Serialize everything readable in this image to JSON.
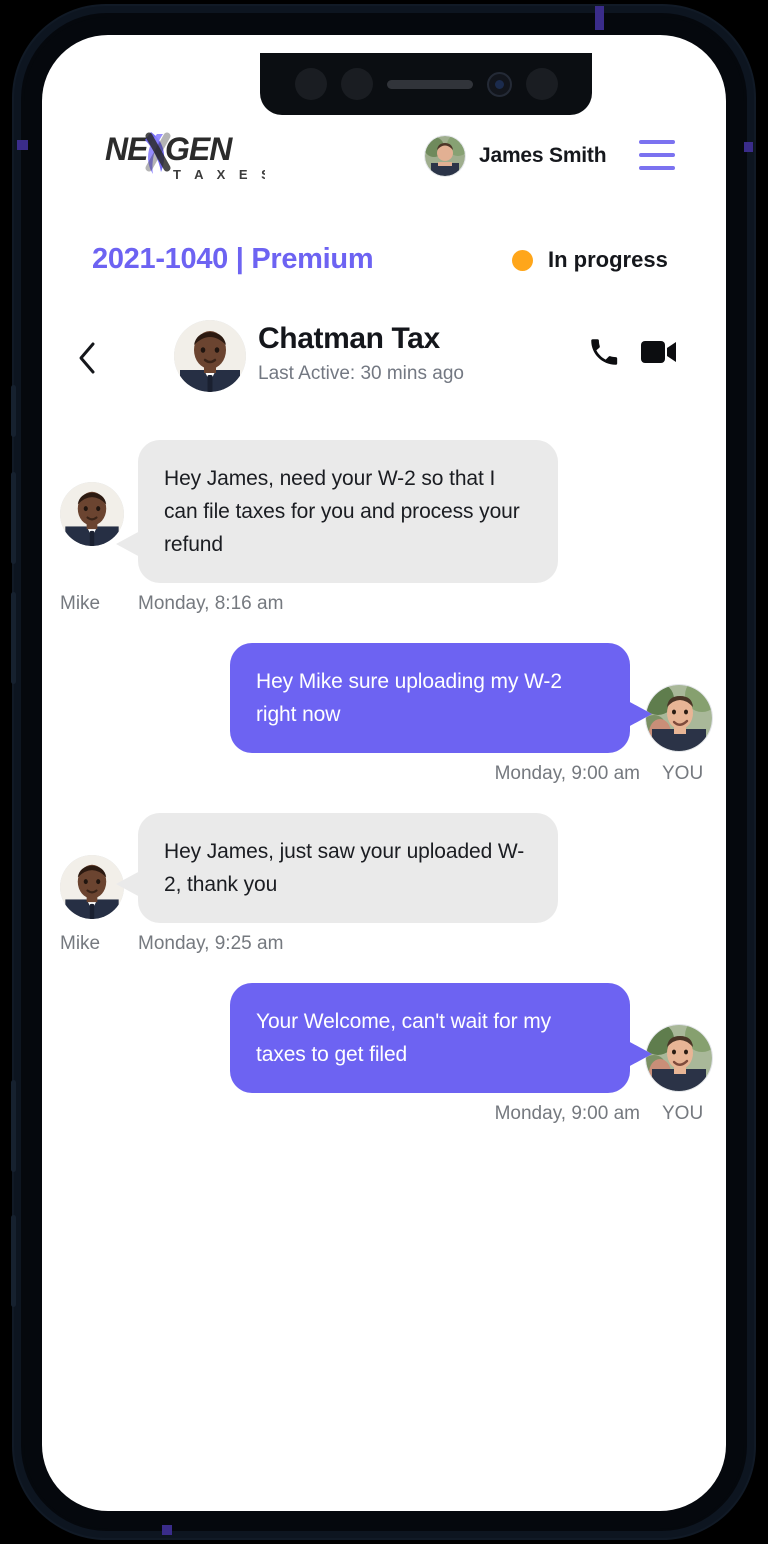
{
  "device": {
    "notch": {
      "sensor_left_icon": "proximity-sensor",
      "sensor_right_icon": "ambient-light-sensor",
      "speaker_icon": "earpiece-speaker",
      "camera_icon": "front-camera"
    },
    "frame_color": "#05080d",
    "accent_color": "#3a2c8a"
  },
  "header": {
    "logo_primary_text": "NE",
    "logo_secondary_text": "GEN",
    "logo_sub_text": "T A X E S",
    "logo_accent_color": "#6d63f2",
    "user_name": "James Smith",
    "avatar_icon": "user-avatar-james",
    "menu_icon": "hamburger-menu-icon",
    "menu_color": "#7b72f0"
  },
  "status": {
    "case_title": "2021-1040 | Premium",
    "case_title_color": "#6d63f2",
    "state_label": "In progress",
    "state_dot_color": "#ffa61a"
  },
  "chat_header": {
    "back_icon": "chevron-left-icon",
    "contact_avatar_icon": "contact-avatar-mike",
    "contact_name": "Chatman Tax",
    "last_active": "Last Active: 30 mins ago",
    "call_icon": "phone-call-icon",
    "video_icon": "video-camera-icon"
  },
  "conversation": {
    "messages": [
      {
        "direction": "incoming",
        "sender": "Mike",
        "text": "Hey James, need your W-2 so that I can file taxes for you and process your refund",
        "timestamp": "Monday, 8:16 am",
        "avatar_icon": "contact-avatar-mike",
        "bubble_color": "#eaeaea",
        "text_color": "#1b1d22"
      },
      {
        "direction": "outgoing",
        "sender": "YOU",
        "text": "Hey Mike sure uploading my W-2 right now",
        "timestamp": "Monday, 9:00 am",
        "avatar_icon": "user-avatar-james",
        "bubble_color": "#6d63f2",
        "text_color": "#ffffff"
      },
      {
        "direction": "incoming",
        "sender": "Mike",
        "text": "Hey James, just saw your uploaded W-2, thank you",
        "timestamp": "Monday, 9:25 am",
        "avatar_icon": "contact-avatar-mike",
        "bubble_color": "#eaeaea",
        "text_color": "#1b1d22"
      },
      {
        "direction": "outgoing",
        "sender": "YOU",
        "text": "Your Welcome, can't wait for my taxes to get filed",
        "timestamp": "Monday, 9:00 am",
        "avatar_icon": "user-avatar-james",
        "bubble_color": "#6d63f2",
        "text_color": "#ffffff"
      }
    ]
  }
}
